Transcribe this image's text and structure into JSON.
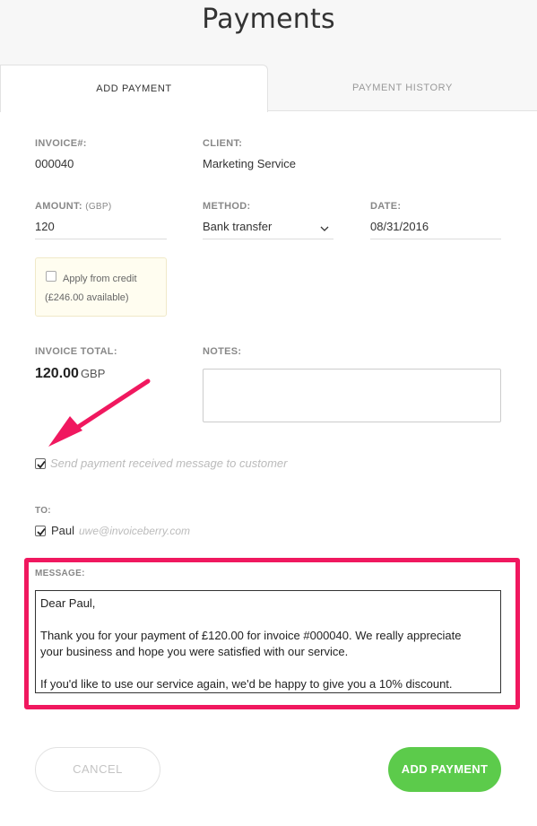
{
  "page": {
    "title": "Payments"
  },
  "tabs": [
    {
      "label": "ADD PAYMENT",
      "active": true
    },
    {
      "label": "PAYMENT HISTORY",
      "active": false
    }
  ],
  "form": {
    "invoice": {
      "label": "INVOICE#:",
      "value": "000040"
    },
    "client": {
      "label": "CLIENT:",
      "value": "Marketing Service"
    },
    "amount": {
      "label": "AMOUNT:",
      "label_unit": "(GBP)",
      "value": "120"
    },
    "method": {
      "label": "METHOD:",
      "value": "Bank transfer"
    },
    "date": {
      "label": "DATE:",
      "value": "08/31/2016"
    },
    "credit": {
      "label": "Apply from credit",
      "available": "(£246.00 available)",
      "checked": false
    },
    "invoice_total": {
      "label": "INVOICE TOTAL:",
      "value": "120.00",
      "currency": "GBP"
    },
    "notes": {
      "label": "NOTES:",
      "value": ""
    },
    "send_message": {
      "label": "Send payment received message to customer",
      "checked": true
    },
    "to": {
      "label": "TO:",
      "name": "Paul",
      "email": "uwe@invoiceberry.com",
      "checked": true
    },
    "message": {
      "label": "MESSAGE:",
      "lines": [
        "Dear Paul,",
        "",
        "Thank you for your payment of £120.00 for invoice #000040. We really appreciate",
        "your business and hope you were satisfied with our service.",
        "",
        "If you'd like to use our service again, we'd be happy to give you a 10% discount."
      ]
    }
  },
  "buttons": {
    "cancel": "CANCEL",
    "add": "ADD PAYMENT"
  },
  "colors": {
    "highlight": "#f0185f",
    "arrow": "#f0185f",
    "add_button": "#5ccb4b",
    "credit_box_bg": "#fffdf0"
  }
}
